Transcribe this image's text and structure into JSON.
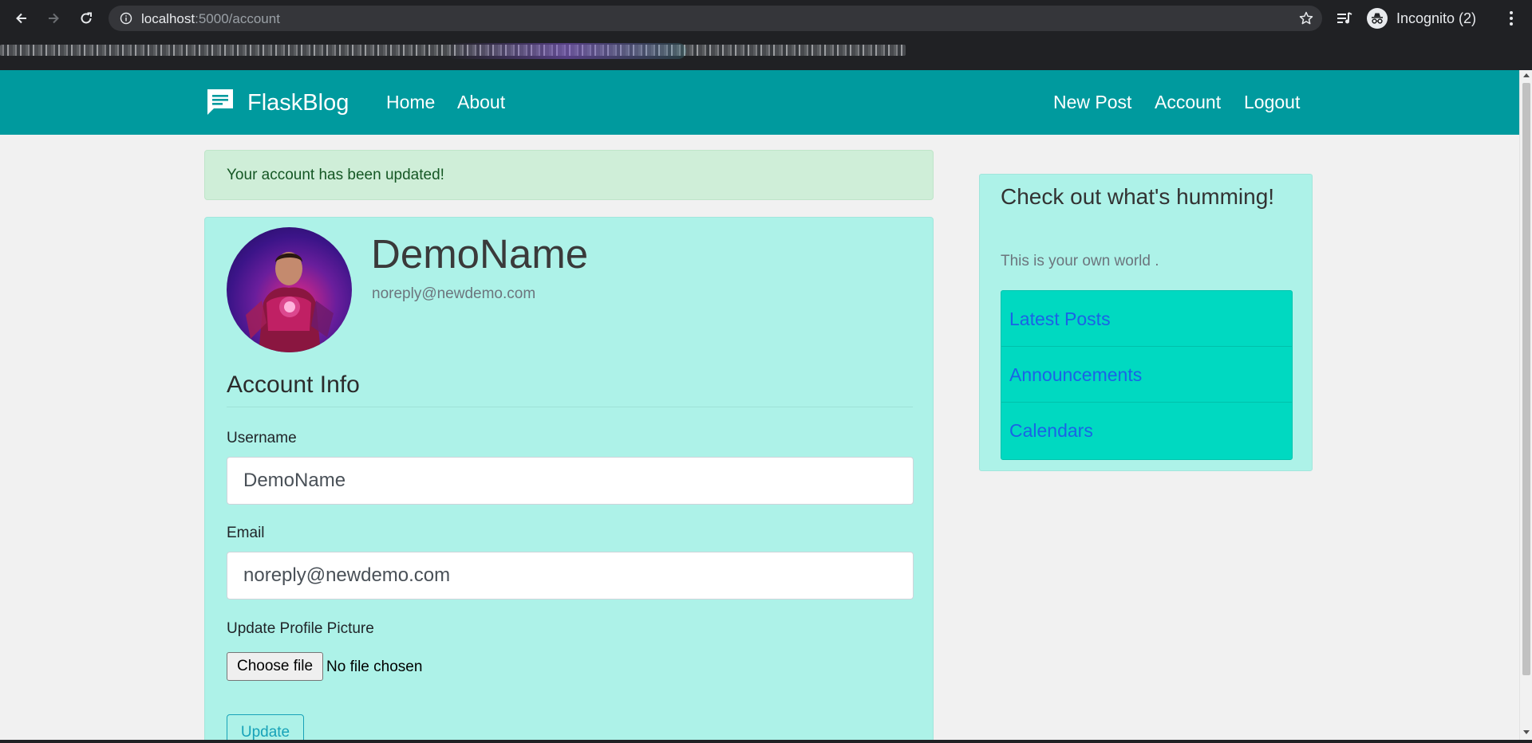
{
  "browser": {
    "url_host": "localhost",
    "url_path": ":5000/account",
    "profile_label": "Incognito (2)",
    "icons": [
      "back-icon",
      "forward-icon",
      "reload-icon",
      "site-info-icon",
      "bookmark-star-icon",
      "media-controls-icon",
      "incognito-icon",
      "menu-kebab-icon"
    ]
  },
  "navbar": {
    "brand": "FlaskBlog",
    "left_links": [
      "Home",
      "About"
    ],
    "right_links": [
      "New Post",
      "Account",
      "Logout"
    ],
    "color": "#009a9e"
  },
  "alert": {
    "message": "Your account has been updated!"
  },
  "profile": {
    "name": "DemoName",
    "email": "noreply@newdemo.com"
  },
  "form": {
    "legend": "Account Info",
    "username_label": "Username",
    "username_value": "DemoName",
    "email_label": "Email",
    "email_value": "noreply@newdemo.com",
    "picture_label": "Update Profile Picture",
    "file_button": "Choose file",
    "file_status": "No file chosen",
    "submit": "Update"
  },
  "sidebar": {
    "title": "Check out what's humming!",
    "subtitle": "This is your own world .",
    "items": [
      "Latest Posts",
      "Announcements",
      "Calendars"
    ]
  },
  "colors": {
    "card_bg": "#adf2e8",
    "list_bg": "#00d9c1",
    "link": "#1a63e6",
    "alert_bg": "#cfeed8"
  }
}
